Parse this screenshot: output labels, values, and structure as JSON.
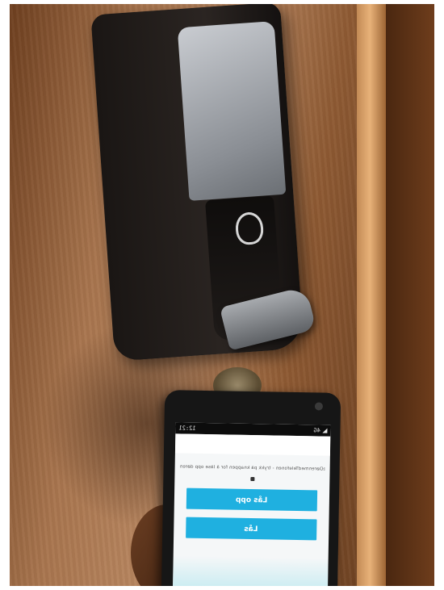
{
  "status_bar": {
    "time": "12:21",
    "network": "4G"
  },
  "screen": {
    "message": "ÅpneDørenmedTelefonen - trykk på knappen for å låse opp døren",
    "buttons": {
      "unlock_label": "Lås opp",
      "lock_label": "Lås"
    },
    "accent_color": "#1fb0e0"
  }
}
